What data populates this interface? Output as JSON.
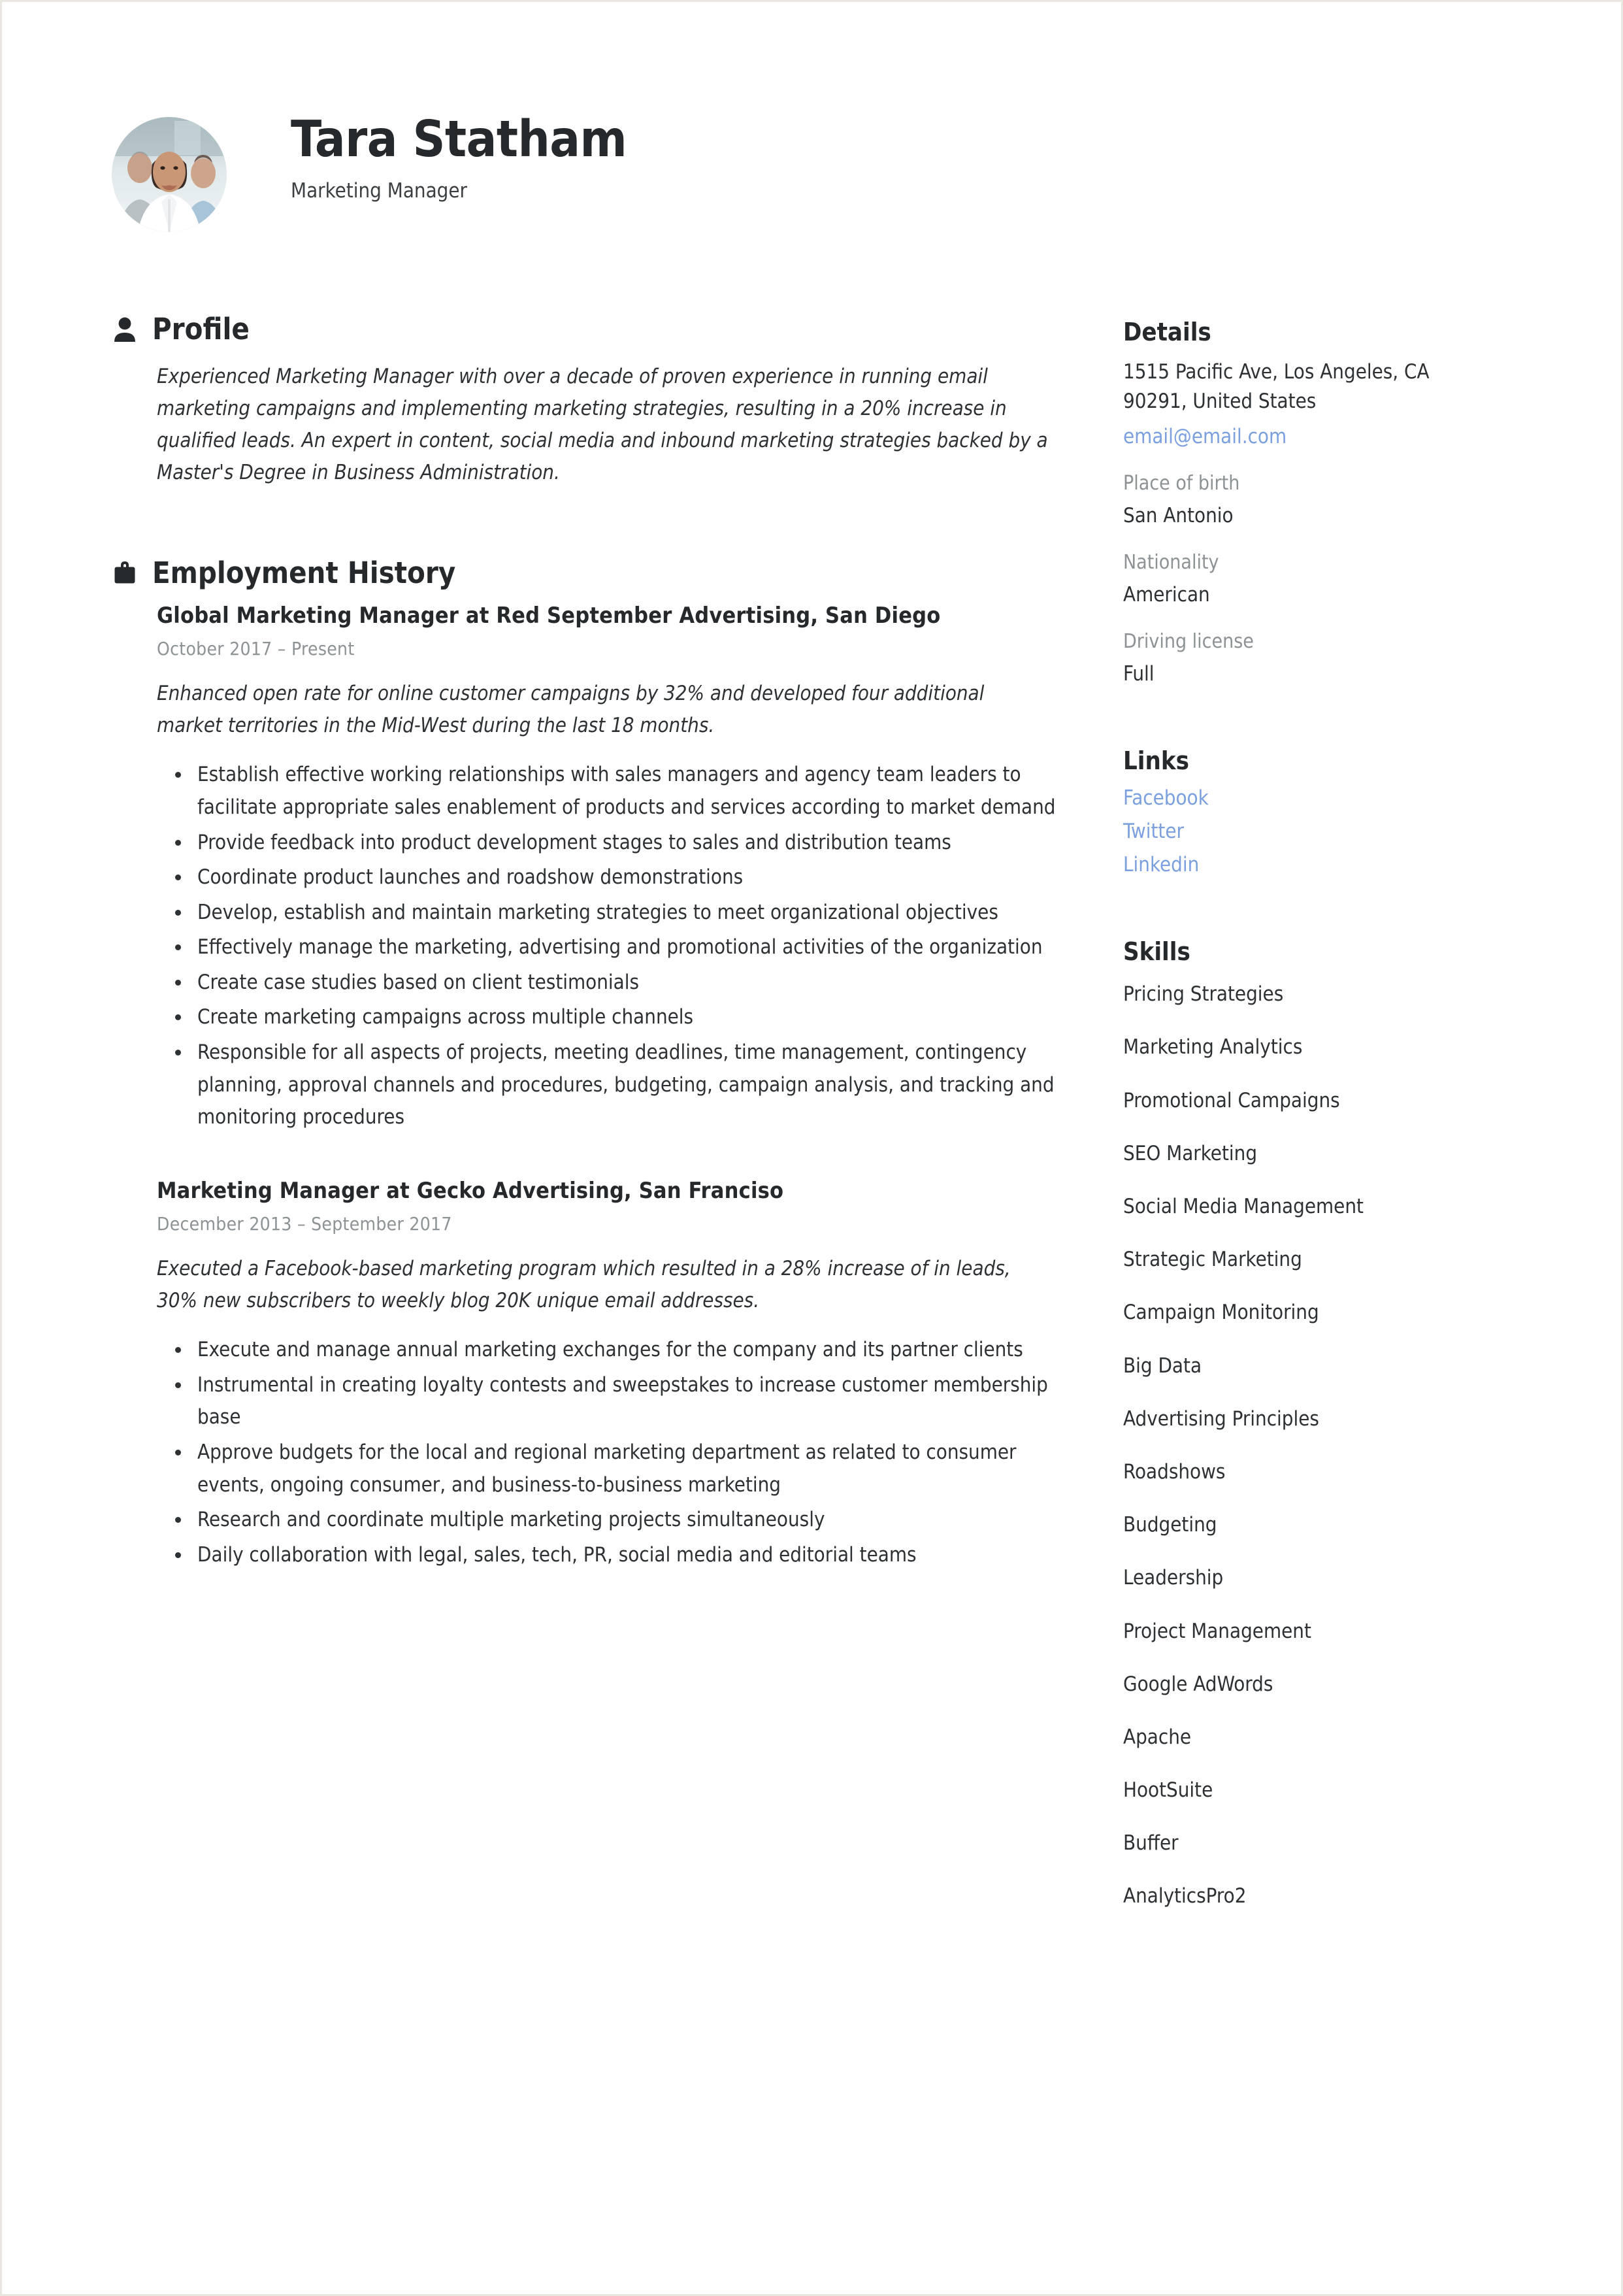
{
  "header": {
    "name": "Tara Statham",
    "job_title": "Marketing Manager",
    "avatar_alt": "avatar-photo"
  },
  "profile": {
    "section_title": "Profile",
    "icon": "person-icon",
    "text": "Experienced Marketing Manager with over a decade of proven experience in running email marketing campaigns and implementing marketing strategies, resulting in a 20% increase in qualified leads. An expert in content, social media and inbound marketing strategies backed by a Master's Degree in Business Administration."
  },
  "employment": {
    "section_title": "Employment History",
    "icon": "briefcase-icon",
    "jobs": [
      {
        "heading": "Global Marketing Manager at Red September Advertising, San Diego",
        "dates": "October 2017  –  Present",
        "summary": "Enhanced open rate for online customer campaigns by 32% and developed four additional market territories in the Mid-West during the last 18 months.",
        "bullets": [
          "Establish effective working relationships with sales managers and agency team leaders to facilitate appropriate sales enablement of products and services according to market demand",
          "Provide feedback into product development stages to sales and distribution teams",
          "Coordinate product launches and roadshow demonstrations",
          "Develop, establish and maintain marketing strategies to meet organizational objectives",
          "Effectively manage the marketing, advertising and promotional activities of the organization",
          "Create case studies based on client testimonials",
          "Create marketing campaigns across multiple channels",
          "Responsible for all aspects of projects, meeting deadlines, time management, contingency planning, approval channels and procedures, budgeting, campaign analysis, and tracking and monitoring procedures"
        ]
      },
      {
        "heading": "Marketing Manager at Gecko Advertising, San Franciso",
        "dates": "December 2013  –  September 2017",
        "summary": "Executed a Facebook-based marketing program which resulted in a 28% increase of in leads, 30% new subscribers to weekly blog  20K unique email addresses.",
        "bullets": [
          "Execute and manage annual marketing exchanges for the company and its partner clients",
          "Instrumental in creating loyalty contests and sweepstakes to increase customer membership base",
          "Approve budgets for the local and regional marketing department as related to consumer events, ongoing consumer, and business-to-business marketing",
          "Research and coordinate multiple marketing projects simultaneously",
          "Daily collaboration with legal, sales, tech, PR, social media and editorial teams"
        ]
      }
    ]
  },
  "details": {
    "section_title": "Details",
    "address_line1": "1515 Pacific Ave, Los Angeles, CA",
    "address_line2": "90291, United States",
    "email": "email@email.com",
    "fields": [
      {
        "label": "Place of birth",
        "value": "San Antonio"
      },
      {
        "label": "Nationality",
        "value": "American"
      },
      {
        "label": "Driving license",
        "value": "Full"
      }
    ]
  },
  "links": {
    "section_title": "Links",
    "items": [
      "Facebook",
      "Twitter",
      "Linkedin"
    ]
  },
  "skills": {
    "section_title": "Skills",
    "items": [
      "Pricing Strategies",
      "Marketing Analytics",
      "Promotional Campaigns",
      "SEO Marketing",
      "Social Media Management",
      "Strategic Marketing",
      "Campaign Monitoring",
      "Big Data",
      "Advertising Principles",
      "Roadshows",
      "Budgeting",
      "Leadership",
      "Project Management",
      "Google AdWords",
      "Apache",
      "HootSuite",
      "Buffer",
      "AnalyticsPro2"
    ]
  },
  "colors": {
    "text": "#2d3133",
    "heading": "#26292b",
    "muted": "#8d9295",
    "link": "#7ba0dd",
    "page_border": "#e9e7e0"
  }
}
